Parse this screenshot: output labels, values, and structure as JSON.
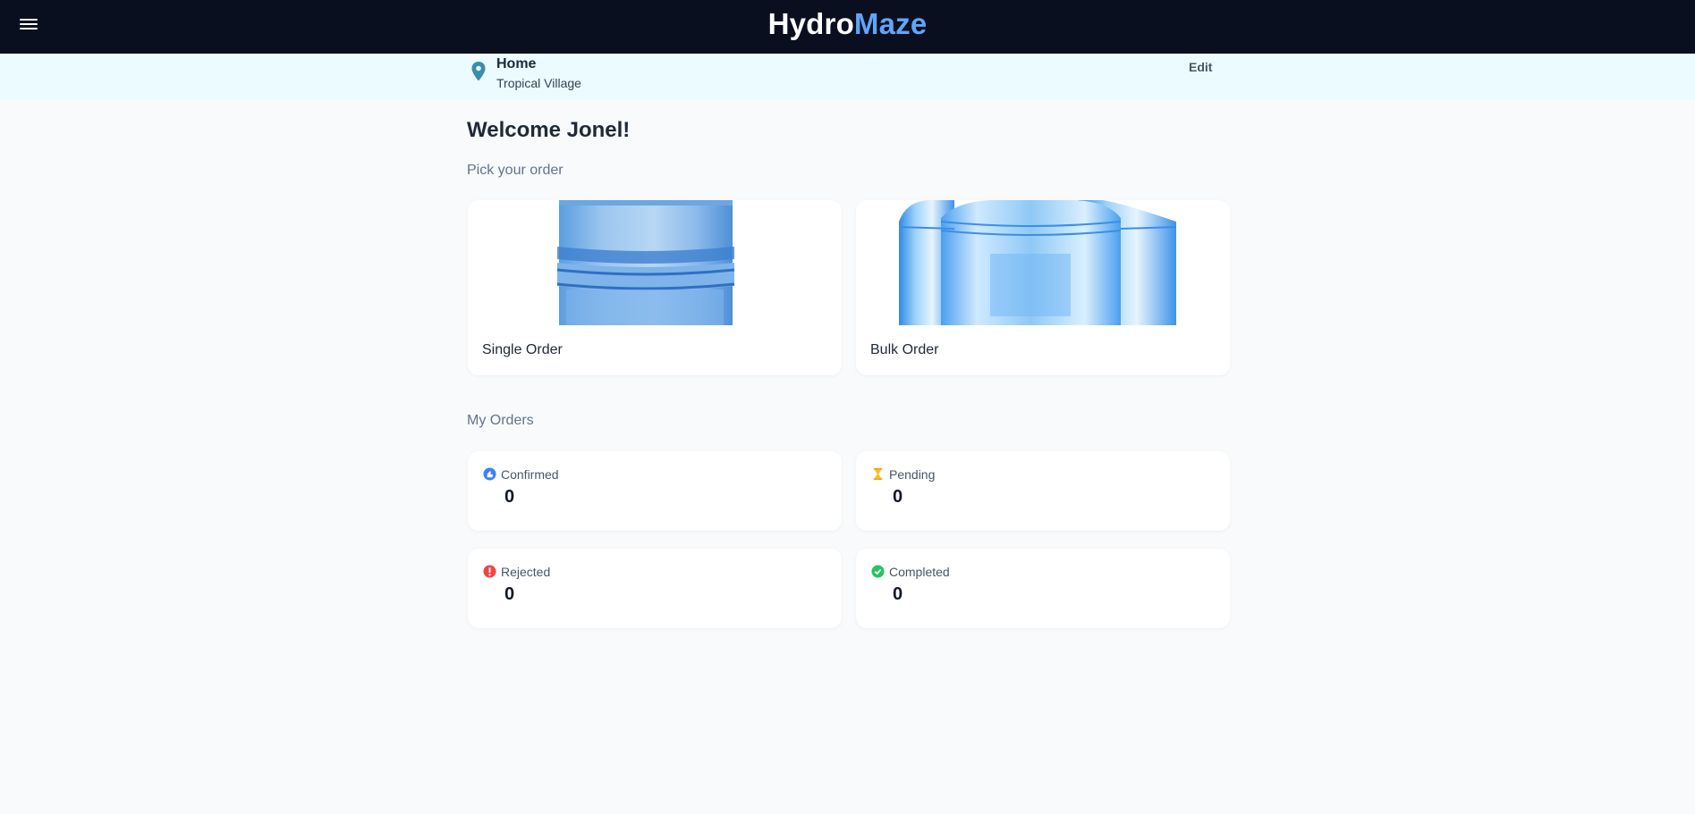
{
  "header": {
    "brand_part1": "Hydro",
    "brand_part2": "Maze",
    "brand_accent_color": "#60a5fa",
    "menu_icon": "hamburger-menu-icon"
  },
  "location": {
    "icon": "map-pin-icon",
    "title": "Home",
    "subtitle": "Tropical Village",
    "edit_label": "Edit"
  },
  "welcome": "Welcome Jonel!",
  "pick_order": {
    "label": "Pick your order",
    "options": [
      {
        "label": "Single Order",
        "image": "single-water-gallon-image"
      },
      {
        "label": "Bulk Order",
        "image": "bulk-water-gallons-image"
      }
    ]
  },
  "my_orders": {
    "label": "My Orders",
    "stats": [
      {
        "label": "Confirmed",
        "value": "0",
        "icon": "thumbs-up-icon",
        "color": "#3b82f6"
      },
      {
        "label": "Pending",
        "value": "0",
        "icon": "hourglass-icon",
        "color": "#f59e0b"
      },
      {
        "label": "Rejected",
        "value": "0",
        "icon": "exclamation-circle-icon",
        "color": "#ef4444"
      },
      {
        "label": "Completed",
        "value": "0",
        "icon": "check-circle-icon",
        "color": "#22c55e"
      }
    ]
  }
}
